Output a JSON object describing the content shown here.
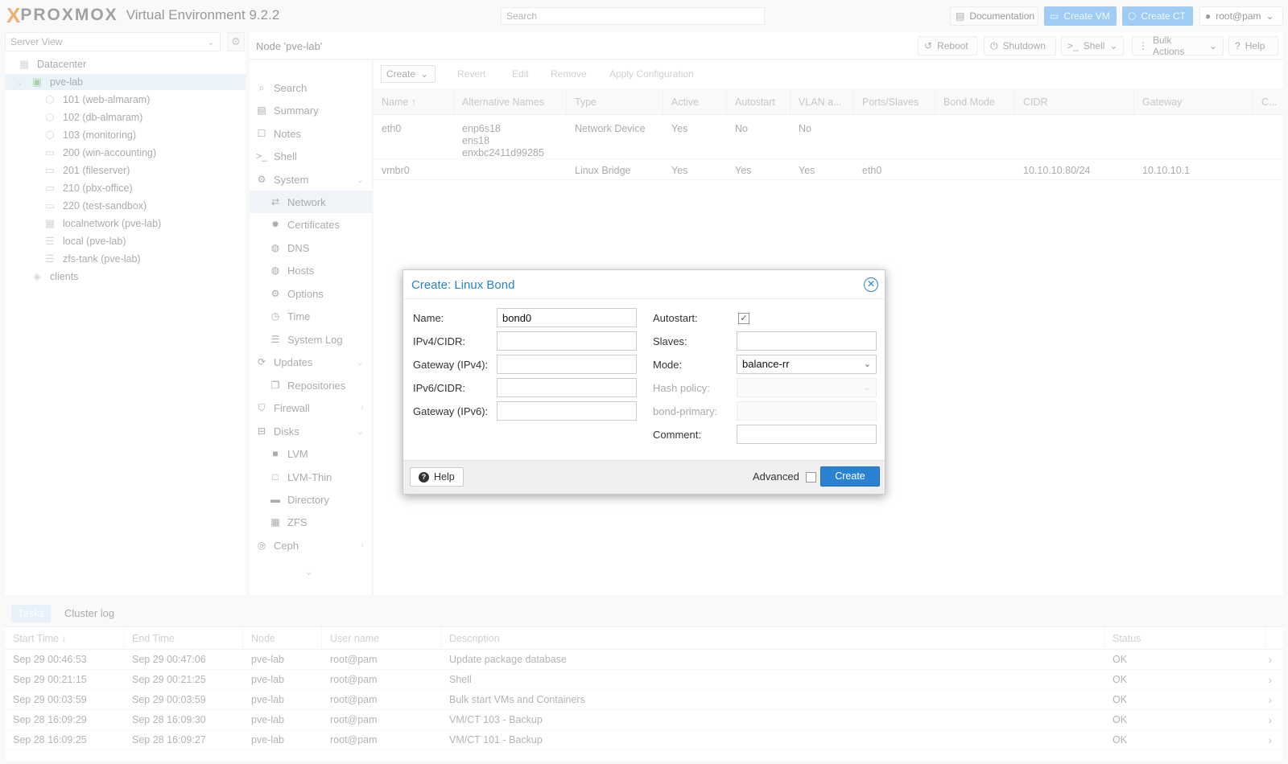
{
  "header": {
    "logo_x": "X",
    "logo_brand": "PROXMOX",
    "version": "Virtual Environment 9.2.2",
    "search_placeholder": "Search",
    "documentation": "Documentation",
    "create_vm": "Create VM",
    "create_ct": "Create CT",
    "user": "root@pam"
  },
  "tree": {
    "view": "Server View",
    "items": [
      {
        "label": "Datacenter",
        "icon": "datacenter-icon"
      },
      {
        "label": "pve-lab",
        "icon": "node-icon"
      },
      {
        "label": "101 (web-almaram)",
        "icon": "container-icon"
      },
      {
        "label": "102 (db-almaram)",
        "icon": "container-icon"
      },
      {
        "label": "103 (monitoring)",
        "icon": "container-icon"
      },
      {
        "label": "200 (win-accounting)",
        "icon": "vm-icon"
      },
      {
        "label": "201 (fileserver)",
        "icon": "vm-icon"
      },
      {
        "label": "210 (pbx-office)",
        "icon": "vm-icon"
      },
      {
        "label": "220 (test-sandbox)",
        "icon": "vm-icon"
      },
      {
        "label": "localnetwork (pve-lab)",
        "icon": "network-grid-icon"
      },
      {
        "label": "local (pve-lab)",
        "icon": "storage-icon"
      },
      {
        "label": "zfs-tank (pve-lab)",
        "icon": "storage-icon"
      },
      {
        "label": "clients",
        "icon": "tags-icon"
      }
    ]
  },
  "node": {
    "title": "Node 'pve-lab'",
    "reboot": "Reboot",
    "shutdown": "Shutdown",
    "shell": "Shell",
    "bulk_actions": "Bulk Actions",
    "help": "Help"
  },
  "nav": {
    "items": [
      {
        "label": "Search"
      },
      {
        "label": "Summary"
      },
      {
        "label": "Notes"
      },
      {
        "label": "Shell"
      },
      {
        "label": "System"
      },
      {
        "label": "Network"
      },
      {
        "label": "Certificates"
      },
      {
        "label": "DNS"
      },
      {
        "label": "Hosts"
      },
      {
        "label": "Options"
      },
      {
        "label": "Time"
      },
      {
        "label": "System Log"
      },
      {
        "label": "Updates"
      },
      {
        "label": "Repositories"
      },
      {
        "label": "Firewall"
      },
      {
        "label": "Disks"
      },
      {
        "label": "LVM"
      },
      {
        "label": "LVM-Thin"
      },
      {
        "label": "Directory"
      },
      {
        "label": "ZFS"
      },
      {
        "label": "Ceph"
      }
    ]
  },
  "network": {
    "toolbar": {
      "create": "Create",
      "revert": "Revert",
      "edit": "Edit",
      "remove": "Remove",
      "apply": "Apply Configuration"
    },
    "columns": [
      "Name ↑",
      "Alternative Names",
      "Type",
      "Active",
      "Autostart",
      "VLAN a...",
      "Ports/Slaves",
      "Bond Mode",
      "CIDR",
      "Gateway",
      "C..."
    ],
    "rows": [
      {
        "name": "eth0",
        "alt1": "enp6s18",
        "alt2": "ens18",
        "alt3": "enxbc2411d99285",
        "type": "Network Device",
        "active": "Yes",
        "autostart": "No",
        "vlan": "No",
        "ports": "",
        "bond": "",
        "cidr": "",
        "gateway": ""
      },
      {
        "name": "vmbr0",
        "alt1": "",
        "alt2": "",
        "alt3": "",
        "type": "Linux Bridge",
        "active": "Yes",
        "autostart": "Yes",
        "vlan": "Yes",
        "ports": "eth0",
        "bond": "",
        "cidr": "10.10.10.80/24",
        "gateway": "10.10.10.1"
      }
    ]
  },
  "tasks": {
    "tab_tasks": "Tasks",
    "tab_cluster": "Cluster log",
    "columns": [
      "Start Time ↓",
      "End Time",
      "Node",
      "User name",
      "Description",
      "Status"
    ],
    "rows": [
      {
        "start": "Sep 29 00:46:53",
        "end": "Sep 29 00:47:06",
        "node": "pve-lab",
        "user": "root@pam",
        "desc": "Update package database",
        "status": "OK"
      },
      {
        "start": "Sep 29 00:21:15",
        "end": "Sep 29 00:21:25",
        "node": "pve-lab",
        "user": "root@pam",
        "desc": "Shell",
        "status": "OK"
      },
      {
        "start": "Sep 29 00:03:59",
        "end": "Sep 29 00:03:59",
        "node": "pve-lab",
        "user": "root@pam",
        "desc": "Bulk start VMs and Containers",
        "status": "OK"
      },
      {
        "start": "Sep 28 16:09:29",
        "end": "Sep 28 16:09:30",
        "node": "pve-lab",
        "user": "root@pam",
        "desc": "VM/CT 103 - Backup",
        "status": "OK"
      },
      {
        "start": "Sep 28 16:09:25",
        "end": "Sep 28 16:09:27",
        "node": "pve-lab",
        "user": "root@pam",
        "desc": "VM/CT 101 - Backup",
        "status": "OK"
      }
    ]
  },
  "dialog": {
    "title": "Create: Linux Bond",
    "name_label": "Name:",
    "name_value": "bond0",
    "ipv4_label": "IPv4/CIDR:",
    "gw4_label": "Gateway (IPv4):",
    "ipv6_label": "IPv6/CIDR:",
    "gw6_label": "Gateway (IPv6):",
    "autostart_label": "Autostart:",
    "slaves_label": "Slaves:",
    "mode_label": "Mode:",
    "mode_value": "balance-rr",
    "hash_label": "Hash policy:",
    "primary_label": "bond-primary:",
    "comment_label": "Comment:",
    "help": "Help",
    "advanced": "Advanced",
    "create": "Create"
  }
}
